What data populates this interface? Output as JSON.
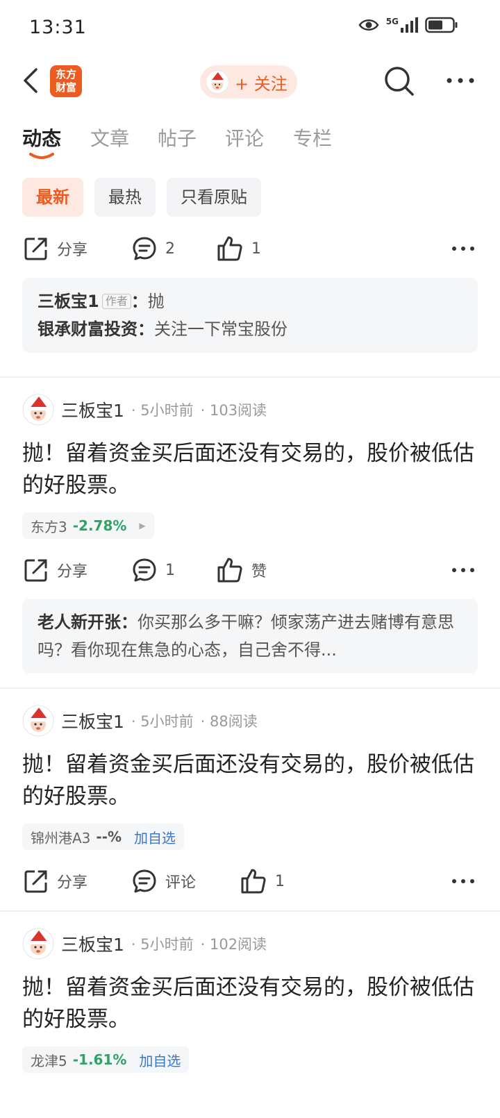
{
  "status": {
    "time": "13:31",
    "network": "5G"
  },
  "header": {
    "logo_line1": "东方",
    "logo_line2": "财富",
    "follow_label": "+ 关注"
  },
  "tabs": [
    {
      "label": "动态",
      "active": true
    },
    {
      "label": "文章",
      "active": false
    },
    {
      "label": "帖子",
      "active": false
    },
    {
      "label": "评论",
      "active": false
    },
    {
      "label": "专栏",
      "active": false
    }
  ],
  "filters": [
    {
      "label": "最新",
      "active": true
    },
    {
      "label": "最热",
      "active": false
    },
    {
      "label": "只看原贴",
      "active": false
    }
  ],
  "top_actions": {
    "share": "分享",
    "comments": "2",
    "likes": "1"
  },
  "top_comments": {
    "line1_user": "三板宝1",
    "line1_tag": "作者",
    "line1_sep": "：",
    "line1_text": "抛",
    "line2_user": "银承财富投资",
    "line2_sep": "：",
    "line2_text": "关注一下常宝股份"
  },
  "posts": [
    {
      "user": "三板宝1",
      "time": "· 5小时前",
      "reads": "· 103阅读",
      "text": "抛！留着资金买后面还没有交易的，股价被低估的好股票。",
      "stock_name": "东方3",
      "stock_change": "-2.78%",
      "share": "分享",
      "comments": "1",
      "likes": "赞",
      "comment_user": "老人新开张",
      "comment_sep": "：",
      "comment_text": "你买那么多干嘛？倾家荡产进去赌博有意思吗？看你现在焦急的心态，自己舍不得..."
    },
    {
      "user": "三板宝1",
      "time": "· 5小时前",
      "reads": "· 88阅读",
      "text": "抛！留着资金买后面还没有交易的，股价被低估的好股票。",
      "stock_name": "锦州港A3",
      "stock_change": "--%",
      "stock_add": "加自选",
      "share": "分享",
      "comments": "评论",
      "likes": "1"
    },
    {
      "user": "三板宝1",
      "time": "· 5小时前",
      "reads": "· 102阅读",
      "text": "抛！留着资金买后面还没有交易的，股价被低估的好股票。",
      "stock_name": "龙津5",
      "stock_change": "-1.61%",
      "stock_add": "加自选"
    }
  ],
  "colors": {
    "accent": "#ec5c20",
    "down": "#2fa366",
    "link": "#3a78c4"
  }
}
